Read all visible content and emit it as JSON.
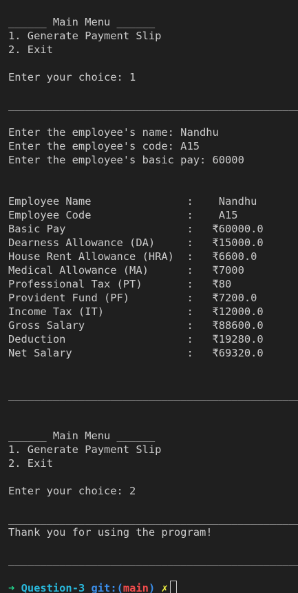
{
  "lines": [
    "______ Main Menu ______",
    "1. Generate Payment Slip",
    "2. Exit",
    "",
    "Enter your choice: 1",
    "",
    "",
    "",
    "Enter the employee's name: Nandhu",
    "Enter the employee's code: A15",
    "Enter the employee's basic pay: 60000",
    "",
    "",
    "Employee Name               :    Nandhu",
    "Employee Code               :    A15",
    "Basic Pay                   :   ₹60000.0",
    "Dearness Allowance (DA)     :   ₹15000.0",
    "House Rent Allowance (HRA)  :   ₹6600.0",
    "Medical Allowance (MA)      :   ₹7000",
    "Professional Tax (PT)       :   ₹80",
    "Provident Fund (PF)         :   ₹7200.0",
    "Income Tax (IT)             :   ₹12000.0",
    "Gross Salary                :   ₹88600.0",
    "Deduction                   :   ₹19280.0",
    "Net Salary                  :   ₹69320.0",
    "",
    "",
    "",
    "",
    "",
    "______ Main Menu ______",
    "1. Generate Payment Slip",
    "2. Exit",
    "",
    "Enter your choice: 2",
    "",
    "",
    "Thank you for using the program!",
    "",
    ""
  ],
  "separator": "________________________________________________________________",
  "prompt": {
    "arrow": "➜",
    "dir": "Question-3",
    "git_label": "git:(",
    "branch": "main",
    "git_close": ")",
    "dirty": "✗"
  },
  "colors": {
    "background": "#1f1f1f",
    "text": "#cccccc",
    "arrow": "#23d18b",
    "dir": "#29b8db",
    "git": "#3b8eea",
    "branch": "#f14c4c",
    "dirty": "#f5f543"
  }
}
